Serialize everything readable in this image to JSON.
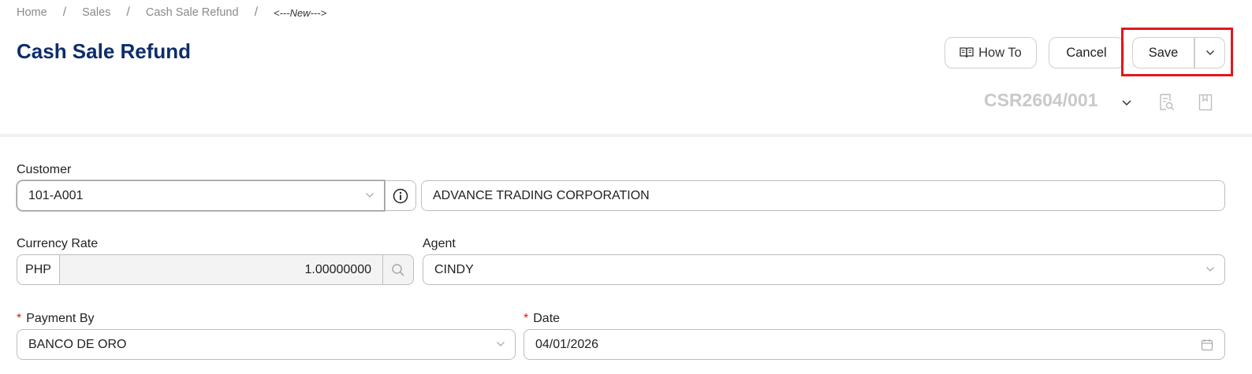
{
  "breadcrumb": {
    "items": [
      "Home",
      "Sales",
      "Cash Sale Refund"
    ],
    "separator": "/",
    "current": "<---New--->"
  },
  "page": {
    "title": "Cash Sale Refund",
    "doc_number": "CSR2604/001"
  },
  "toolbar": {
    "how_to_label": "How To",
    "cancel_label": "Cancel",
    "save_label": "Save"
  },
  "form": {
    "customer": {
      "label": "Customer",
      "code": "101-A001",
      "name": "ADVANCE TRADING CORPORATION"
    },
    "currency_rate": {
      "label": "Currency Rate",
      "currency": "PHP",
      "rate": "1.00000000"
    },
    "agent": {
      "label": "Agent",
      "value": "CINDY"
    },
    "payment_by": {
      "label": "Payment By",
      "required_mark": "*",
      "value": "BANCO DE ORO"
    },
    "date": {
      "label": "Date",
      "required_mark": "*",
      "value": "04/01/2026"
    }
  },
  "colors": {
    "title": "#0d2d6b",
    "highlight": "#e0181e",
    "doc_number": "#c9c9c9"
  },
  "icons": [
    "book-icon",
    "chevron-down-icon",
    "info-icon",
    "search-icon",
    "calendar-icon",
    "preview-icon",
    "bookmark-icon"
  ]
}
